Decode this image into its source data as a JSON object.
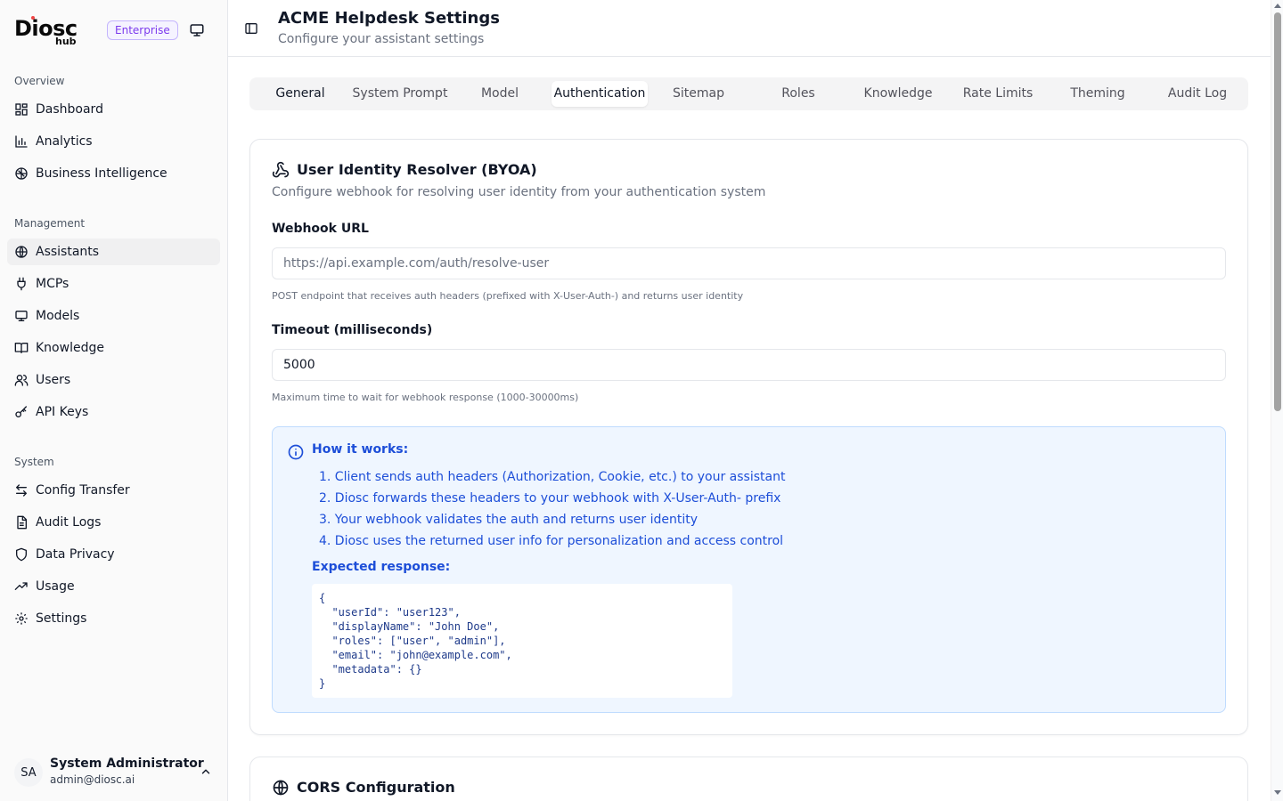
{
  "brand": {
    "name": "Diosc",
    "sub": "hub",
    "badge": "Enterprise"
  },
  "sidebar": {
    "sections": [
      {
        "title": "Overview",
        "items": [
          {
            "label": "Dashboard",
            "icon": "dashboard-icon"
          },
          {
            "label": "Analytics",
            "icon": "bar-chart-icon"
          },
          {
            "label": "Business Intelligence",
            "icon": "brain-icon"
          }
        ]
      },
      {
        "title": "Management",
        "items": [
          {
            "label": "Assistants",
            "icon": "globe-icon",
            "active": true
          },
          {
            "label": "MCPs",
            "icon": "plug-icon"
          },
          {
            "label": "Models",
            "icon": "monitor-icon"
          },
          {
            "label": "Knowledge",
            "icon": "book-icon"
          },
          {
            "label": "Users",
            "icon": "users-icon"
          },
          {
            "label": "API Keys",
            "icon": "key-icon"
          }
        ]
      },
      {
        "title": "System",
        "items": [
          {
            "label": "Config Transfer",
            "icon": "arrows-icon"
          },
          {
            "label": "Audit Logs",
            "icon": "file-icon"
          },
          {
            "label": "Data Privacy",
            "icon": "shield-icon"
          },
          {
            "label": "Usage",
            "icon": "trending-icon"
          },
          {
            "label": "Settings",
            "icon": "gear-icon"
          }
        ]
      }
    ],
    "user": {
      "initials": "SA",
      "name": "System Administrator",
      "email": "admin@diosc.ai"
    }
  },
  "header": {
    "title": "ACME Helpdesk Settings",
    "subtitle": "Configure your assistant settings"
  },
  "tabs": [
    {
      "label": "General"
    },
    {
      "label": "System Prompt"
    },
    {
      "label": "Model"
    },
    {
      "label": "Authentication",
      "selected": true
    },
    {
      "label": "Sitemap"
    },
    {
      "label": "Roles"
    },
    {
      "label": "Knowledge"
    },
    {
      "label": "Rate Limits"
    },
    {
      "label": "Theming"
    },
    {
      "label": "Audit Log"
    }
  ],
  "identity": {
    "title": "User Identity Resolver (BYOA)",
    "description": "Configure webhook for resolving user identity from your authentication system",
    "webhook": {
      "label": "Webhook URL",
      "value": "",
      "placeholder": "https://api.example.com/auth/resolve-user",
      "help": "POST endpoint that receives auth headers (prefixed with X-User-Auth-) and returns user identity"
    },
    "timeout": {
      "label": "Timeout (milliseconds)",
      "value": "5000",
      "help": "Maximum time to wait for webhook response (1000-30000ms)"
    },
    "info": {
      "heading": "How it works:",
      "steps": [
        "1. Client sends auth headers (Authorization, Cookie, etc.) to your assistant",
        "2. Diosc forwards these headers to your webhook with X-User-Auth- prefix",
        "3. Your webhook validates the auth and returns user identity",
        "4. Diosc uses the returned user info for personalization and access control"
      ],
      "expected_heading": "Expected response:",
      "code": "{\n  \"userId\": \"user123\",\n  \"displayName\": \"John Doe\",\n  \"roles\": [\"user\", \"admin\"],\n  \"email\": \"john@example.com\",\n  \"metadata\": {}\n}"
    }
  },
  "cors": {
    "title": "CORS Configuration"
  },
  "colors": {
    "accent": "#1d4ed8",
    "badge": "#7c3aed",
    "info_bg": "#eff6ff"
  }
}
